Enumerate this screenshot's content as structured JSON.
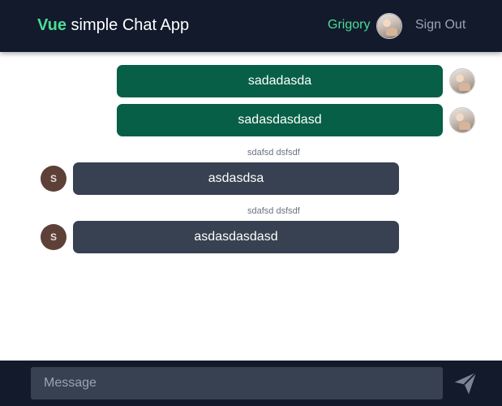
{
  "header": {
    "brand_accent": "Vue",
    "brand_rest": " simple Chat App",
    "user_name": "Grigory",
    "avatar_icon": "user-photo",
    "signout_label": "Sign Out"
  },
  "messages": [
    {
      "text": "sadadasda",
      "mine": true
    },
    {
      "text": "sadasdasdasd",
      "mine": true
    },
    {
      "sender": "sdafsd dsfsdf",
      "avatar_letter": "S",
      "text": "asdasdsa",
      "mine": false
    },
    {
      "sender": "sdafsd dsfsdf",
      "avatar_letter": "S",
      "text": "asdasdasdasd",
      "mine": false
    }
  ],
  "composer": {
    "placeholder": "Message",
    "value": "",
    "send_icon": "paper-plane"
  },
  "colors": {
    "header_bg": "#121a2c",
    "accent": "#4ade95",
    "mine_bubble": "#065f46",
    "theirs_bubble": "#374151",
    "letter_avatar": "#5d4037"
  }
}
